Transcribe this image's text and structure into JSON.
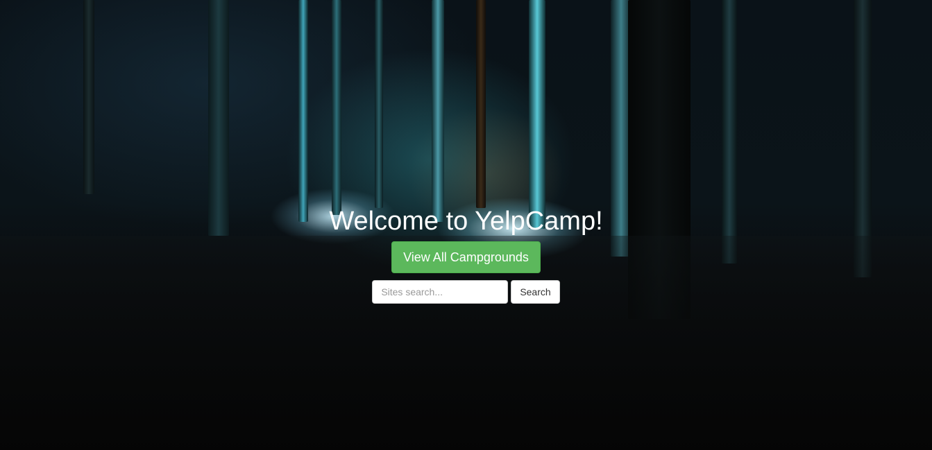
{
  "hero": {
    "title": "Welcome to YelpCamp!",
    "view_all_label": "View All Campgrounds",
    "background_description": "night forest campsite with glowing tents",
    "accent_color": "#5cb85c"
  },
  "search": {
    "placeholder": "Sites search...",
    "value": "",
    "button_label": "Search"
  }
}
